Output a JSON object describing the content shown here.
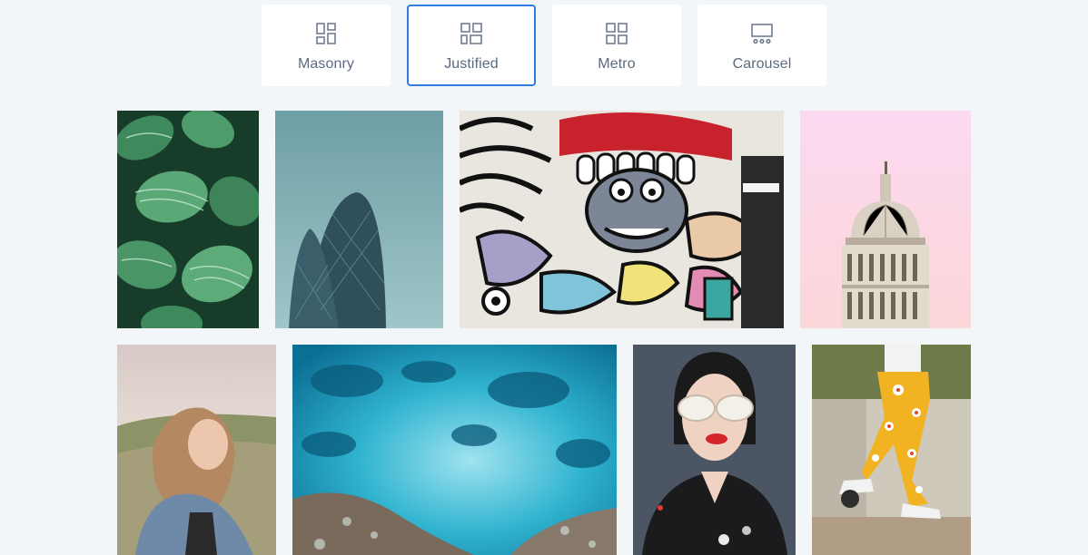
{
  "layout_tabs": [
    {
      "label": "Masonry",
      "icon": "masonry-layout-icon",
      "active": false
    },
    {
      "label": "Justified",
      "icon": "justified-layout-icon",
      "active": true
    },
    {
      "label": "Metro",
      "icon": "metro-layout-icon",
      "active": false
    },
    {
      "label": "Carousel",
      "icon": "carousel-layout-icon",
      "active": false
    }
  ],
  "colors": {
    "background": "#f3f6f9",
    "tab_background": "#ffffff",
    "active_border": "#2f7de1",
    "icon_stroke": "#6f7d8f",
    "label_text": "#5b6b7f"
  },
  "gallery": [
    {
      "subject": "striped green leaves"
    },
    {
      "subject": "glass skyscrapers against teal sky"
    },
    {
      "subject": "colorful graffiti wall"
    },
    {
      "subject": "dome against pink sky"
    },
    {
      "subject": "smiling woman in denim jacket in field"
    },
    {
      "subject": "aerial view of turquoise ocean"
    },
    {
      "subject": "woman with white sunglasses and red lips"
    },
    {
      "subject": "person in yellow patterned trousers"
    }
  ]
}
